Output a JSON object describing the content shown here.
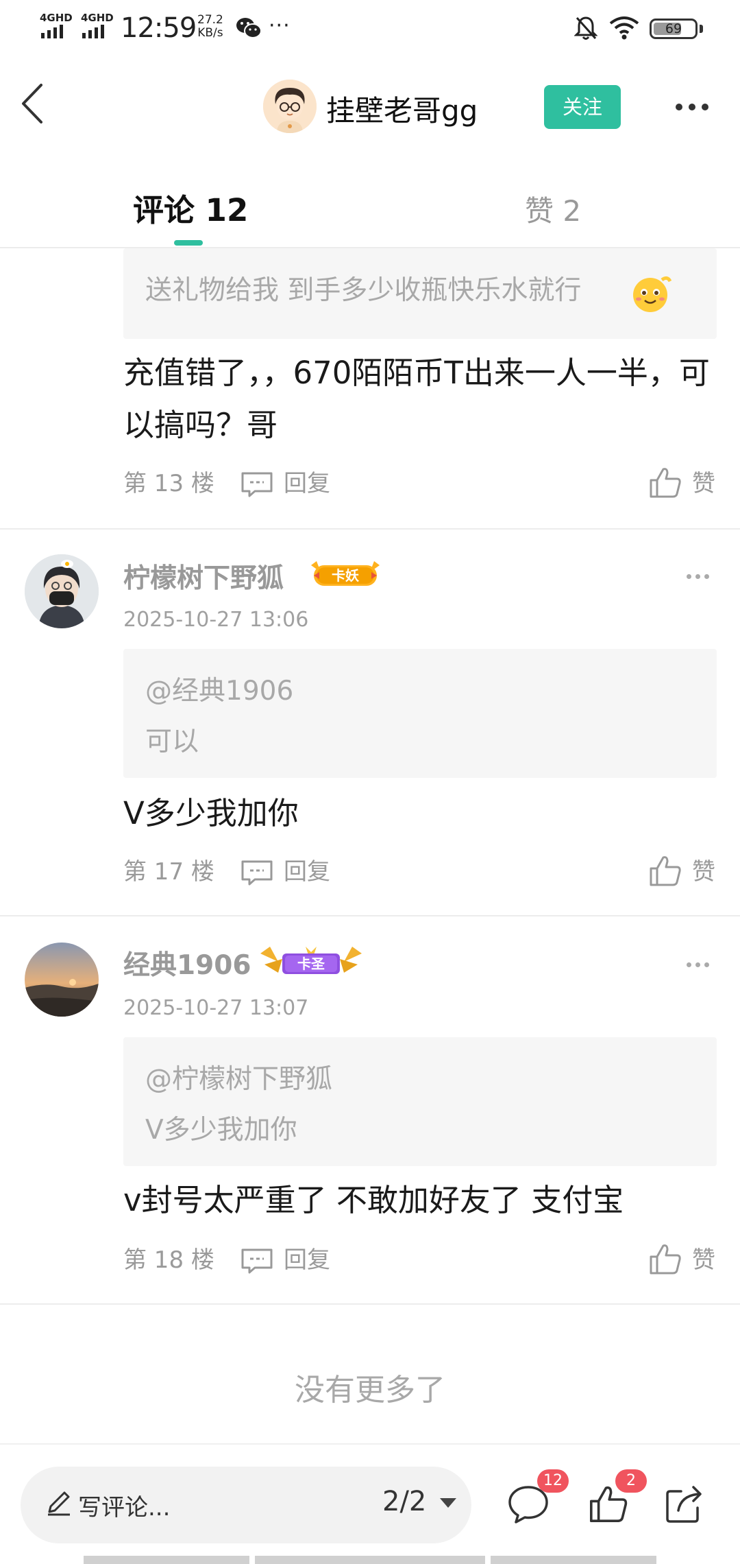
{
  "status_bar": {
    "net1": "4GHD",
    "net2": "4GHD",
    "time": "12:59",
    "speed_value": "27.2",
    "speed_unit": "KB/s",
    "dots": "···",
    "battery": "69",
    "battery_level": 0.69
  },
  "header": {
    "username": "挂壁老哥gg",
    "follow_label": "关注"
  },
  "tabs": {
    "comments": "评论 12",
    "likes": "赞 2"
  },
  "comments": [
    {
      "quote_lines": [
        "送礼物给我  到手多少收瓶快乐水就行"
      ],
      "body": "充值错了，，670陌陌币T出来一人一半，可以搞吗？哥",
      "floor": "第 13 楼",
      "reply": "回复",
      "like": "赞"
    },
    {
      "username": "柠檬树下野狐",
      "badge": "卡妖",
      "timestamp": "2025-10-27 13:06",
      "quote_lines": [
        "@经典1906",
        "可以"
      ],
      "body": "V多少我加你",
      "floor": "第 17 楼",
      "reply": "回复",
      "like": "赞"
    },
    {
      "username": "经典1906",
      "badge": "卡圣",
      "timestamp": "2025-10-27 13:07",
      "quote_lines": [
        "@柠檬树下野狐",
        "V多少我加你"
      ],
      "body": "v封号太严重了  不敢加好友了  支付宝",
      "floor": "第 18 楼",
      "reply": "回复",
      "like": "赞"
    }
  ],
  "no_more": "没有更多了",
  "bottom_bar": {
    "placeholder": "写评论...",
    "page": "2/2",
    "comment_count": "12",
    "like_count": "2"
  },
  "colors": {
    "accent": "#2fbf9f",
    "badge_red": "#f0545e"
  }
}
